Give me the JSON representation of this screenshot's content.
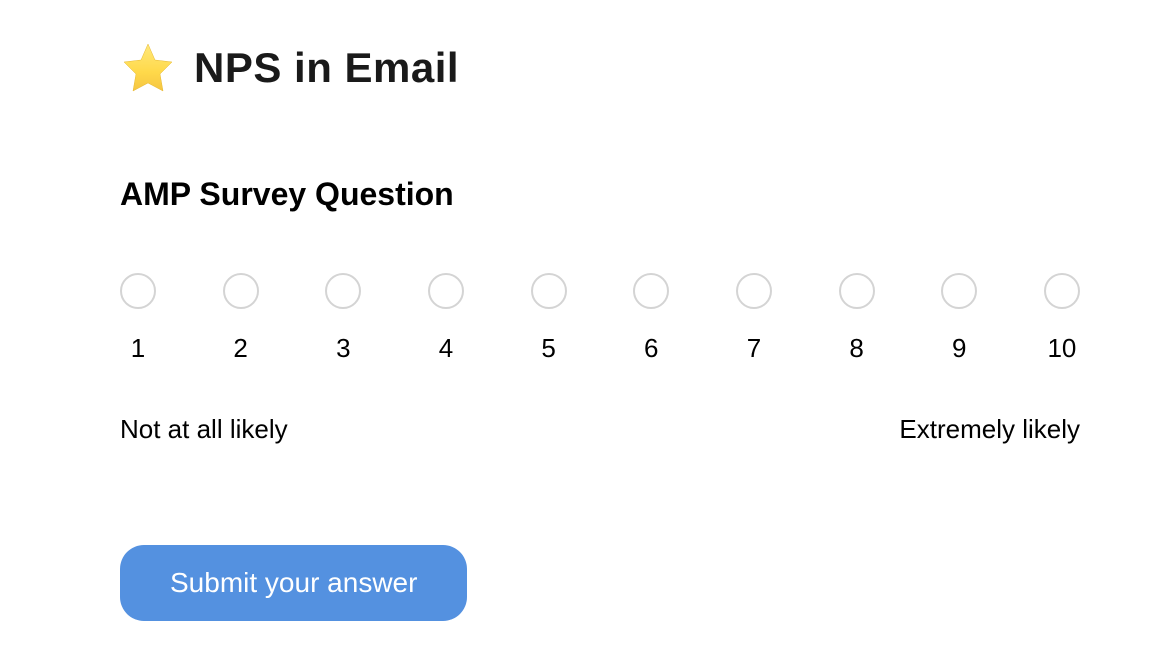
{
  "header": {
    "title": "NPS in Email"
  },
  "survey": {
    "question_title": "AMP Survey Question",
    "options": [
      {
        "value": "1"
      },
      {
        "value": "2"
      },
      {
        "value": "3"
      },
      {
        "value": "4"
      },
      {
        "value": "5"
      },
      {
        "value": "6"
      },
      {
        "value": "7"
      },
      {
        "value": "8"
      },
      {
        "value": "9"
      },
      {
        "value": "10"
      }
    ],
    "low_label": "Not at all likely",
    "high_label": "Extremely likely",
    "submit_label": "Submit your answer"
  }
}
